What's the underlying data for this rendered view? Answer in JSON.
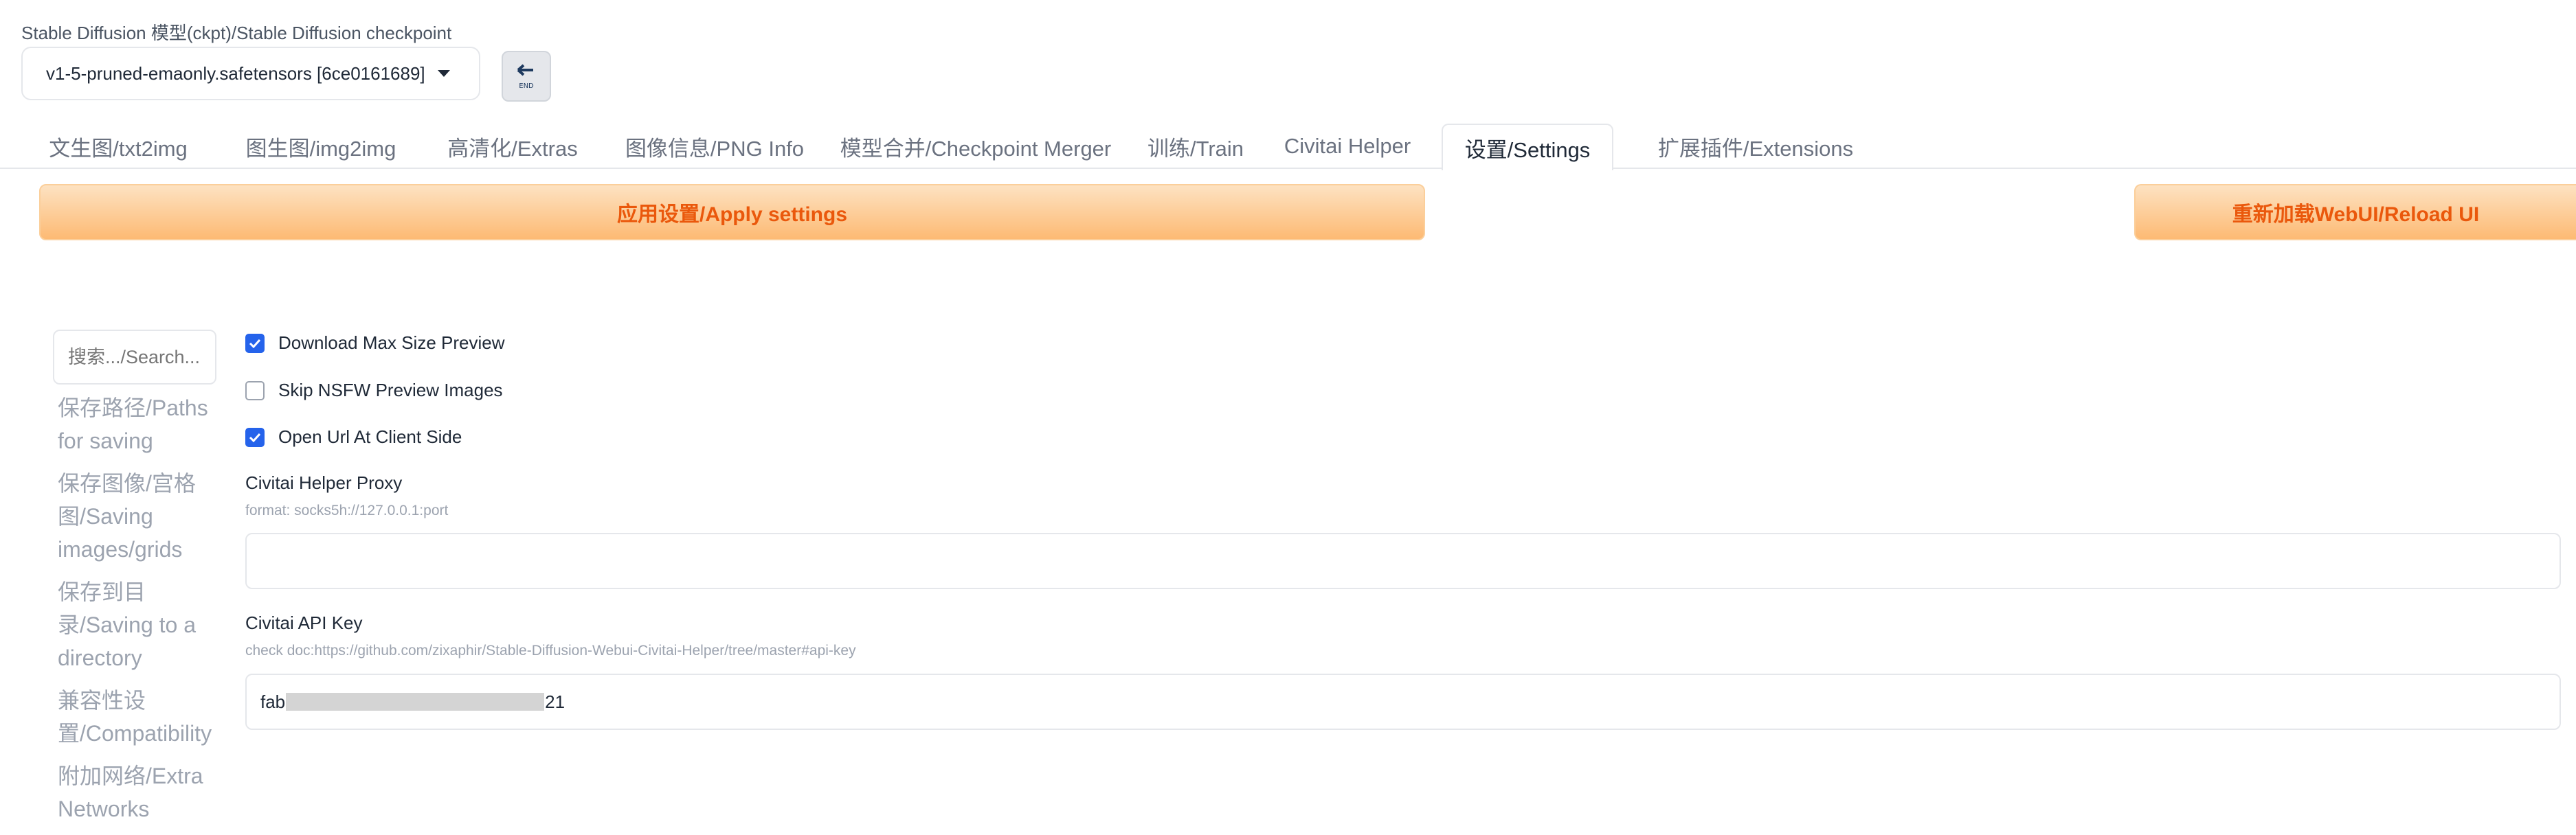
{
  "checkpoint": {
    "label": "Stable Diffusion 模型(ckpt)/Stable Diffusion checkpoint",
    "selected": "v1-5-pruned-emaonly.safetensors [6ce0161689]",
    "refresh_icon": "refresh-icon"
  },
  "tabs": [
    {
      "label": "文生图/txt2img"
    },
    {
      "label": "图生图/img2img"
    },
    {
      "label": "高清化/Extras"
    },
    {
      "label": "图像信息/PNG Info"
    },
    {
      "label": "模型合并/Checkpoint Merger"
    },
    {
      "label": "训练/Train"
    },
    {
      "label": "Civitai Helper"
    },
    {
      "label": "设置/Settings"
    },
    {
      "label": "扩展插件/Extensions"
    }
  ],
  "active_tab": "设置/Settings",
  "actions": {
    "apply_label": "应用设置/Apply settings",
    "reload_label": "重新加载WebUI/Reload UI"
  },
  "settings_nav": {
    "search_placeholder": "搜索.../Search...",
    "items": [
      {
        "label": "保存路径/Paths for saving"
      },
      {
        "label": "保存图像/宫格图/Saving images/grids"
      },
      {
        "label": "保存到目录/Saving to a directory"
      },
      {
        "label": "兼容性设置/Compatibility"
      },
      {
        "label": "附加网络/Extra Networks"
      }
    ]
  },
  "civitai_settings": {
    "download_max_size_preview": {
      "label": "Download Max Size Preview",
      "checked": true
    },
    "skip_nsfw_preview": {
      "label": "Skip NSFW Preview Images",
      "checked": false
    },
    "open_url_client_side": {
      "label": "Open Url At Client Side",
      "checked": true
    },
    "proxy": {
      "label": "Civitai Helper Proxy",
      "hint": "format: socks5h://127.0.0.1:port",
      "value": ""
    },
    "api_key": {
      "label": "Civitai API Key",
      "hint": "check doc:https://github.com/zixaphir/Stable-Diffusion-Webui-Civitai-Helper/tree/master#api-key",
      "value_prefix": "fab",
      "value_suffix": "21"
    }
  },
  "colors": {
    "accent_orange": "#ea580c",
    "checkbox_blue": "#2563eb"
  }
}
